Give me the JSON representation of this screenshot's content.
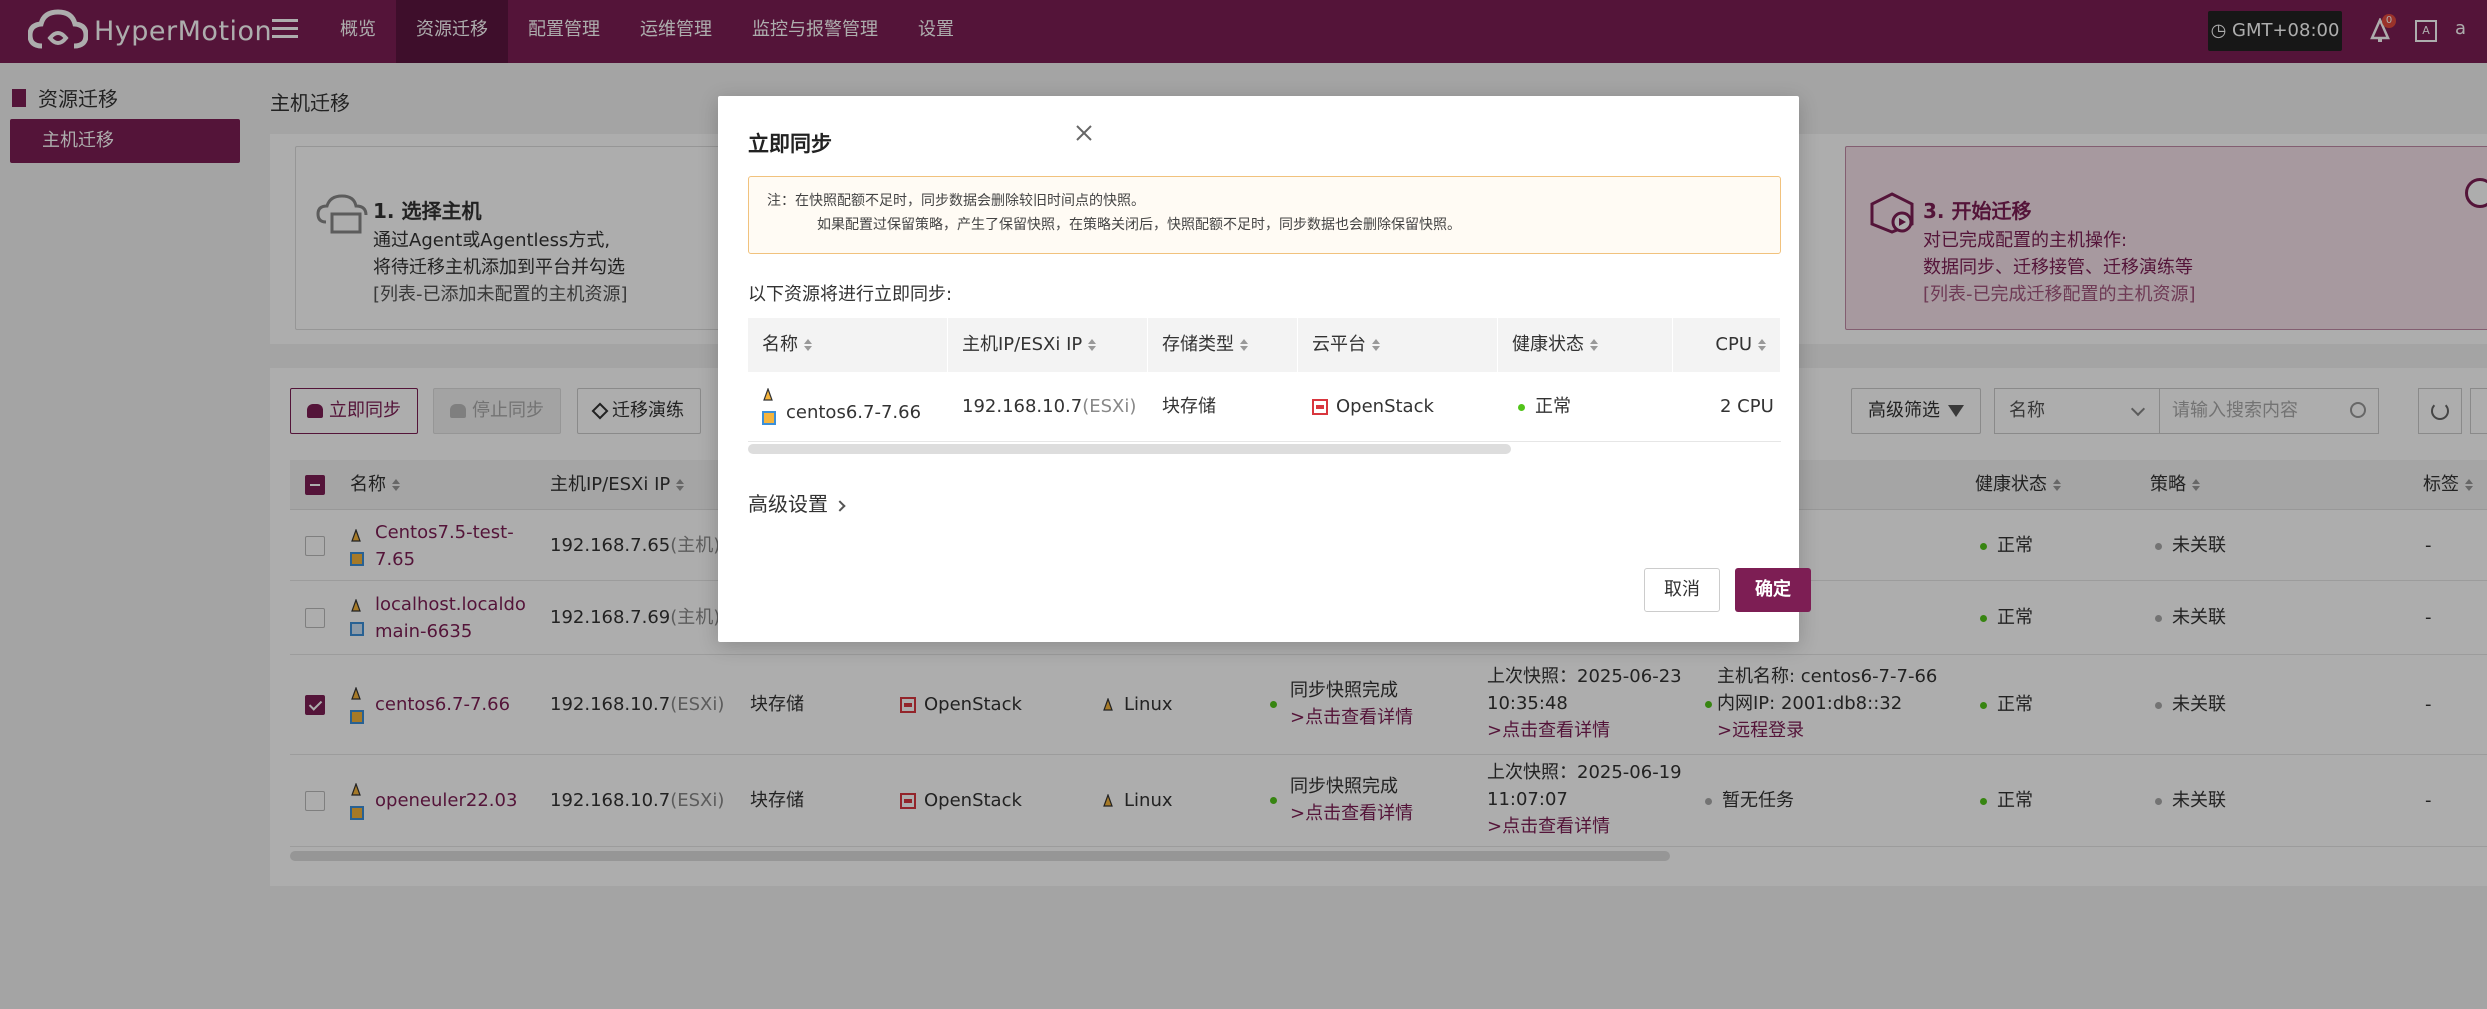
{
  "app": {
    "name": "HyperMotion"
  },
  "nav": {
    "items": [
      {
        "label": "概览"
      },
      {
        "label": "资源迁移"
      },
      {
        "label": "配置管理"
      },
      {
        "label": "运维管理"
      },
      {
        "label": "监控与报警管理"
      },
      {
        "label": "设置"
      }
    ],
    "active_index": 1
  },
  "header": {
    "timezone": "GMT+08:00",
    "notification_count": "0",
    "lang_label": "A",
    "user_initial": "a"
  },
  "sidebar": {
    "title": "资源迁移",
    "items": [
      {
        "label": "主机迁移"
      }
    ]
  },
  "page": {
    "title": "主机迁移"
  },
  "steps": [
    {
      "title": "1. 选择主机",
      "lines": [
        "通过Agent或Agentless方式,",
        "将待迁移主机添加到平台并勾选"
      ],
      "sub": "[列表-已添加未配置的主机资源]"
    },
    {
      "title": "3. 开始迁移",
      "lines": [
        "对已完成配置的主机操作:",
        "数据同步、迁移接管、迁移演练等"
      ],
      "sub": "[列表-已完成迁移配置的主机资源]"
    }
  ],
  "toolbar": {
    "sync_now": "立即同步",
    "stop_sync": "停止同步",
    "drill": "迁移演练",
    "advanced_filter": "高级筛选",
    "filter_field": "名称",
    "search_placeholder": "请输入搜索内容"
  },
  "table": {
    "headers": {
      "name": "名称",
      "ip": "主机IP/ESXi IP",
      "health": "健康状态",
      "policy": "策略",
      "tags": "标签"
    },
    "rows": [
      {
        "name": "Centos7.5-test-7.65",
        "name_l1": "Centos7.5-test-",
        "name_l2": "7.65",
        "ip": "192.168.7.65",
        "ip_suffix": "(主机)",
        "checked": false,
        "health": "正常",
        "policy": "未关联",
        "tags": "-"
      },
      {
        "name": "localhost.localdomain-6635",
        "name_l1": "localhost.localdo",
        "name_l2": "main-6635",
        "ip": "192.168.7.69",
        "ip_suffix": "(主机)",
        "checked": false,
        "health": "正常",
        "policy": "未关联",
        "tags": "-"
      },
      {
        "name": "centos6.7-7.66",
        "ip": "192.168.10.7",
        "ip_suffix": "(ESXi)",
        "storage": "块存储",
        "cloud": "OpenStack",
        "os": "Linux",
        "sync_status": "同步快照完成",
        "sync_link": ">点击查看详情",
        "snapshot": "上次快照：2025-06-23",
        "snapshot_time": "10:35:48",
        "snapshot_link": ">点击查看详情",
        "task_l1": "主机名称: centos6-7-7-66",
        "task_l2": "内网IP: 2001:db8::32",
        "task_link": ">远程登录",
        "checked": true,
        "health": "正常",
        "policy": "未关联",
        "tags": "-"
      },
      {
        "name": "openeuler22.03",
        "ip": "192.168.10.7",
        "ip_suffix": "(ESXi)",
        "storage": "块存储",
        "cloud": "OpenStack",
        "os": "Linux",
        "sync_status": "同步快照完成",
        "sync_link": ">点击查看详情",
        "snapshot": "上次快照：2025-06-19",
        "snapshot_time": "11:07:07",
        "snapshot_link": ">点击查看详情",
        "task_l1": "暂无任务",
        "checked": false,
        "health": "正常",
        "policy": "未关联",
        "tags": "-"
      }
    ]
  },
  "modal": {
    "title": "立即同步",
    "warning_l1": "注：在快照配额不足时，同步数据会删除较旧时间点的快照。",
    "warning_l2": "如果配置过保留策略，产生了保留快照，在策略关闭后，快照配额不足时，同步数据也会删除保留快照。",
    "intro": "以下资源将进行立即同步:",
    "headers": {
      "name": "名称",
      "ip": "主机IP/ESXi IP",
      "storage": "存储类型",
      "cloud": "云平台",
      "health": "健康状态",
      "cpu": "CPU"
    },
    "row": {
      "name": "centos6.7-7.66",
      "ip": "192.168.10.7",
      "ip_suffix": "(ESXi)",
      "storage": "块存储",
      "cloud": "OpenStack",
      "health": "正常",
      "cpu": "2 CPU"
    },
    "advanced": "高级设置",
    "cancel": "取消",
    "confirm": "确定"
  },
  "colors": {
    "brand": "#7d1e54",
    "success": "#52c41a",
    "warning_border": "#f1c27d"
  }
}
